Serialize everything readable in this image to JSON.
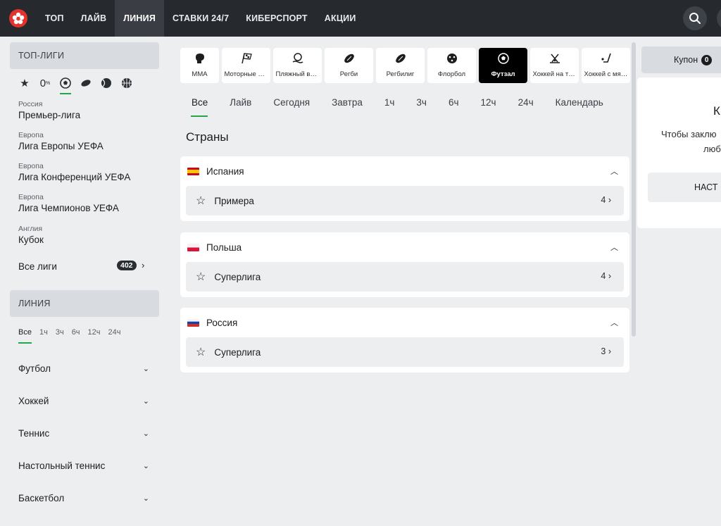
{
  "topbar": {
    "nav": [
      "ТОП",
      "ЛАЙВ",
      "ЛИНИЯ",
      "СТАВКИ 24/7",
      "КИБЕРСПОРТ",
      "АКЦИИ"
    ],
    "active": "ЛИНИЯ"
  },
  "sidebar": {
    "top_leagues_title": "ТОП-ЛИГИ",
    "zero_label": "0",
    "leagues": [
      {
        "region": "Россия",
        "name": "Премьер-лига"
      },
      {
        "region": "Европа",
        "name": "Лига Европы УЕФА"
      },
      {
        "region": "Европа",
        "name": "Лига Конференций УЕФА"
      },
      {
        "region": "Европа",
        "name": "Лига Чемпионов УЕФА"
      },
      {
        "region": "Англия",
        "name": "Кубок"
      }
    ],
    "all_leagues_label": "Все лиги",
    "all_leagues_count": "402",
    "line_title": "ЛИНИЯ",
    "time_filters": [
      "Все",
      "1ч",
      "3ч",
      "6ч",
      "12ч",
      "24ч"
    ],
    "sports": [
      "Футбол",
      "Хоккей",
      "Теннис",
      "Настольный теннис",
      "Баскетбол"
    ]
  },
  "main": {
    "sport_tiles": [
      {
        "label": "MMA",
        "icon": "mma-glove-icon"
      },
      {
        "label": "Моторные виды",
        "icon": "racing-flag-icon"
      },
      {
        "label": "Пляжный волейбол",
        "icon": "beach-volleyball-icon"
      },
      {
        "label": "Регби",
        "icon": "rugby-ball-icon"
      },
      {
        "label": "Регбилиг",
        "icon": "rugby-league-icon"
      },
      {
        "label": "Флорбол",
        "icon": "floorball-icon"
      },
      {
        "label": "Футзал",
        "icon": "futsal-ball-icon"
      },
      {
        "label": "Хоккей на траве",
        "icon": "field-hockey-icon"
      },
      {
        "label": "Хоккей с мячом",
        "icon": "bandy-icon"
      }
    ],
    "active_tile": "Футзал",
    "period_tabs": [
      "Все",
      "Лайв",
      "Сегодня",
      "Завтра",
      "1ч",
      "3ч",
      "6ч",
      "12ч",
      "24ч",
      "Календарь"
    ],
    "countries_title": "Страны",
    "countries": [
      {
        "name": "Испания",
        "flag": [
          "#c60b1e",
          "#ffc400",
          "#c60b1e"
        ],
        "championship": "Примера",
        "count": "4"
      },
      {
        "name": "Польша",
        "flag": [
          "#ffffff",
          "#dc143c"
        ],
        "championship": "Суперлига",
        "count": "4"
      },
      {
        "name": "Россия",
        "flag": [
          "#ffffff",
          "#1c3fa0",
          "#d52b1e"
        ],
        "championship": "Суперлига",
        "count": "3"
      }
    ]
  },
  "coupon": {
    "button_label": "Купон",
    "count": "0",
    "title": "К",
    "text_line1": "Чтобы заклю",
    "text_line2": "любо",
    "settings_label": "НАСТ"
  },
  "colors": {
    "topbar": "#26292d",
    "accent_green": "#26a44a",
    "logo_red": "#e3332f"
  }
}
